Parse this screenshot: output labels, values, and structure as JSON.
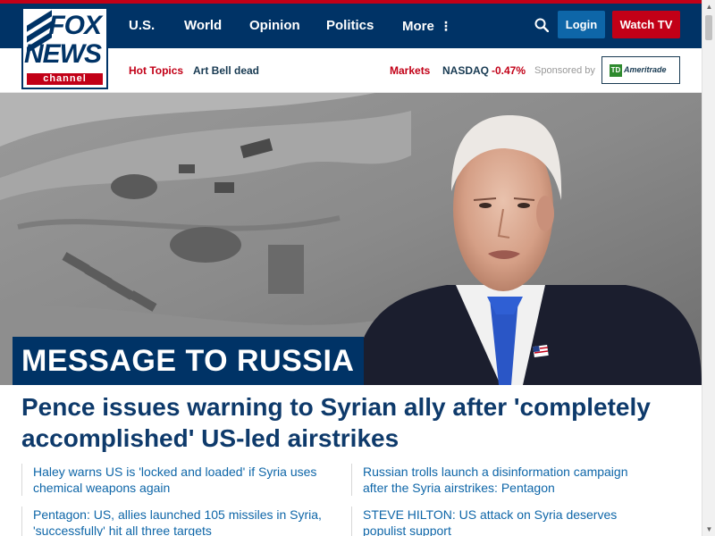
{
  "header": {
    "logo": {
      "line1": "FOX",
      "line2": "NEWS",
      "line3": "channel"
    },
    "nav": [
      {
        "label": "U.S."
      },
      {
        "label": "World"
      },
      {
        "label": "Opinion"
      },
      {
        "label": "Politics"
      },
      {
        "label": "More"
      }
    ],
    "login_label": "Login",
    "watch_label": "Watch TV"
  },
  "subnav": {
    "hot_topics_label": "Hot Topics",
    "hot_topic_1": "Art Bell dead",
    "markets_label": "Markets",
    "index_name": "NASDAQ",
    "index_change": "-0.47%",
    "sponsored_label": "Sponsored by",
    "sponsor_name": "Ameritrade",
    "sponsor_badge": "TD"
  },
  "hero": {
    "label": "MESSAGE TO RUSSIA",
    "headline": "Pence issues warning to Syrian ally after 'completely accomplished' US-led airstrikes"
  },
  "stories": [
    {
      "title": "Haley warns US is 'locked and loaded' if Syria uses chemical weapons again"
    },
    {
      "title": "Russian trolls launch a disinformation campaign after the Syria airstrikes: Pentagon"
    },
    {
      "title": "Pentagon: US, allies launched 105 missiles in Syria, 'successfully' hit all three targets"
    },
    {
      "title": "STEVE HILTON: US attack on Syria deserves populist support"
    }
  ],
  "colors": {
    "brand_navy": "#003366",
    "brand_red": "#c20017",
    "link_blue": "#0e66a8",
    "headline_navy": "#0e3a6b"
  },
  "icons": {
    "search": "search-icon",
    "more": "vertical-dots-icon",
    "flag": "flag-pin-icon"
  }
}
